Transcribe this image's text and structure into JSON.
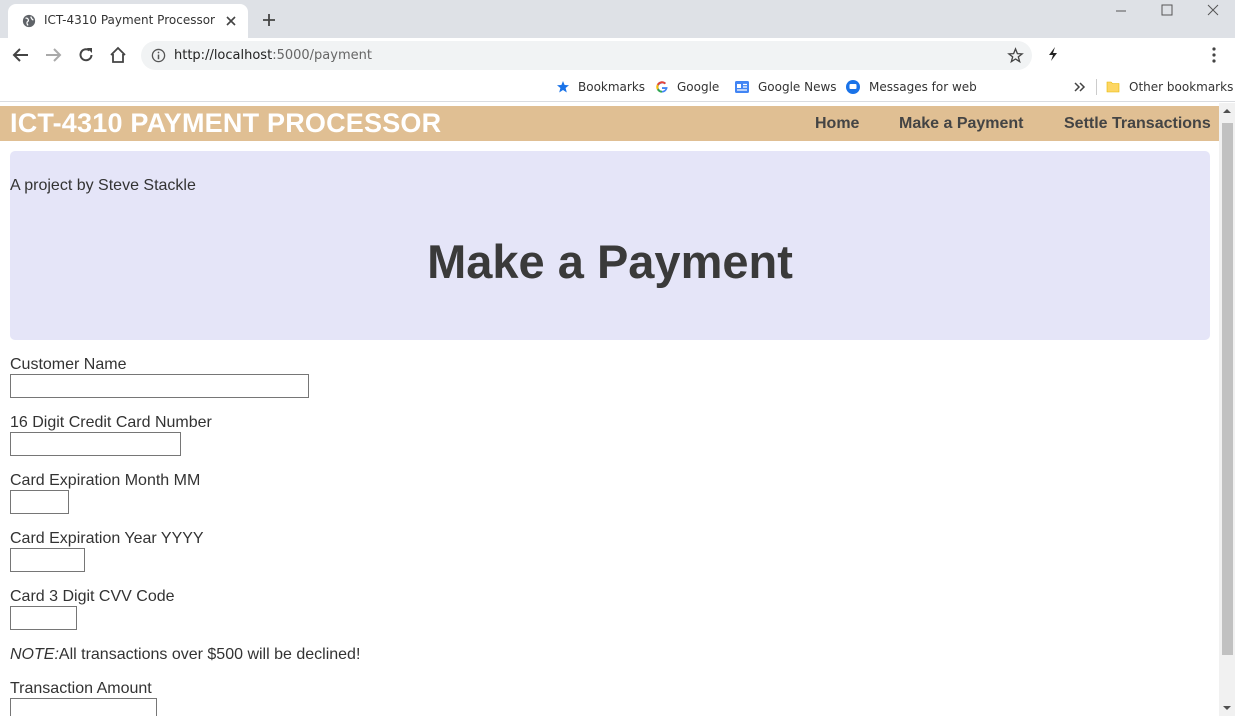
{
  "browser": {
    "tab_title": "ICT-4310 Payment Processor",
    "url_host": "http://localhost",
    "url_path": ":5000/payment",
    "bookmarks": [
      {
        "label": "Bookmarks",
        "icon": "star-icon"
      },
      {
        "label": "Google",
        "icon": "google-icon"
      },
      {
        "label": "Google News",
        "icon": "google-news-icon"
      },
      {
        "label": "Messages for web",
        "icon": "messages-icon"
      }
    ],
    "other_bookmarks": "Other bookmarks"
  },
  "site": {
    "brand": "ICT-4310 PAYMENT PROCESSOR",
    "nav": [
      "Home",
      "Make a Payment",
      "Settle Transactions"
    ],
    "byline": "A project by Steve Stackle",
    "page_title": "Make a Payment"
  },
  "form": {
    "customer_name_label": "Customer Name",
    "card_number_label": "16 Digit Credit Card Number",
    "exp_month_label": "Card Expiration Month MM",
    "exp_year_label": "Card Expiration Year YYYY",
    "cvv_label": "Card 3 Digit CVV Code",
    "note_prefix": "NOTE:",
    "note_text": "All transactions over $500 will be declined!",
    "amount_label": "Transaction Amount"
  },
  "colors": {
    "header_bg": "#e0bf93",
    "hero_bg": "#e5e5f8"
  }
}
